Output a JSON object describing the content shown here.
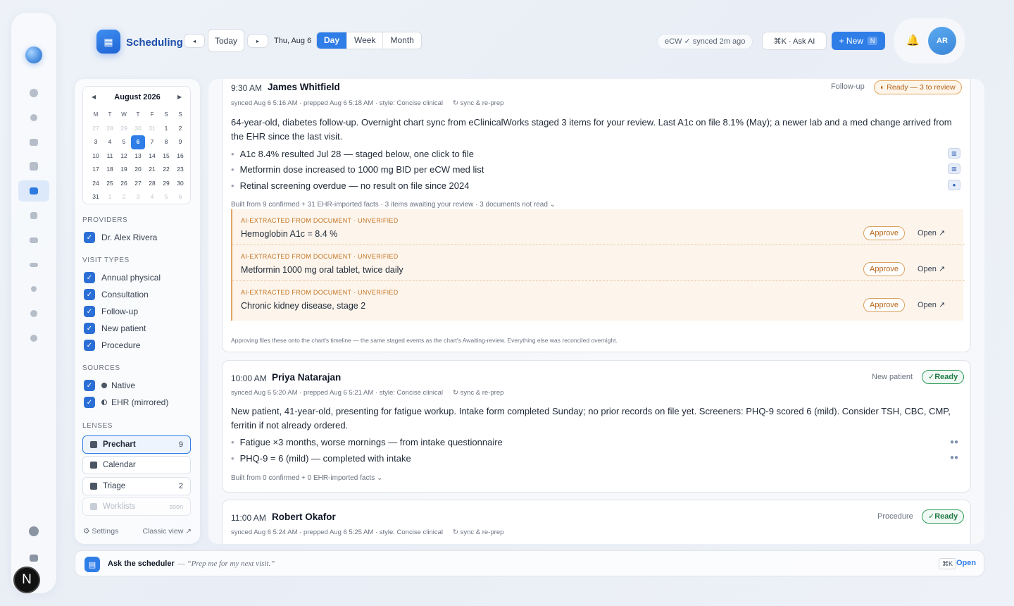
{
  "header": {
    "app_title": "Scheduling",
    "prev_label": "◂",
    "today_label": "Today",
    "next_label": "▸",
    "date_label": "Thu, Aug 6",
    "views": [
      "Day",
      "Week",
      "Month"
    ],
    "active_view": "Day",
    "sync_status": "eCW ✓ synced 2m ago",
    "ask_ai_label": "⌘K · Ask AI",
    "new_label": "+ New",
    "new_kbd": "N",
    "avatar_initials": "AR"
  },
  "calendar": {
    "month_label": "August 2026",
    "dow": [
      "M",
      "T",
      "W",
      "T",
      "F",
      "S",
      "S"
    ],
    "weeks": [
      [
        "27",
        "28",
        "29",
        "30",
        "31",
        "1",
        "2"
      ],
      [
        "3",
        "4",
        "5",
        "6",
        "7",
        "8",
        "9"
      ],
      [
        "10",
        "11",
        "12",
        "13",
        "14",
        "15",
        "16"
      ],
      [
        "17",
        "18",
        "19",
        "20",
        "21",
        "22",
        "23"
      ],
      [
        "24",
        "25",
        "26",
        "27",
        "28",
        "29",
        "30"
      ],
      [
        "31",
        "1",
        "2",
        "3",
        "4",
        "5",
        "6"
      ]
    ],
    "selected_day": "6"
  },
  "sidebar": {
    "providers_label": "PROVIDERS",
    "providers": [
      "Dr. Alex Rivera"
    ],
    "visit_types_label": "VISIT TYPES",
    "visit_types": [
      "Annual physical",
      "Consultation",
      "Follow-up",
      "New patient",
      "Procedure"
    ],
    "sources_label": "SOURCES",
    "sources": [
      "Native",
      "EHR (mirrored)"
    ],
    "lenses_label": "LENSES",
    "lenses": [
      {
        "label": "Prechart",
        "count": "9"
      },
      {
        "label": "Calendar",
        "count": ""
      },
      {
        "label": "Triage",
        "count": "2"
      },
      {
        "label": "Worklists",
        "count": "soon"
      }
    ],
    "settings_label": "Settings",
    "classic_label": "Classic view ↗"
  },
  "appointments": [
    {
      "time": "9:30 AM",
      "name": "James Whitfield",
      "meta": "synced Aug 6 5:16 AM · prepped Aug 6 5:18 AM · style: Concise clinical",
      "sync_action": "sync & re-prep",
      "visit_type": "Follow-up",
      "status": "Ready — 3 to review",
      "summary": "64-year-old, diabetes follow-up. Overnight chart sync from eClinicalWorks staged 3 items for your review. Last A1c on file 8.1% (May); a newer lab and a med change arrived from the EHR since the last visit.",
      "bullets": [
        "A1c 8.4% resulted Jul 28 — staged below, one click to file",
        "Metformin dose increased to 1000 mg BID per eCW med list",
        "Retinal screening overdue — no result on file since 2024"
      ],
      "built_from": "Built from 9 confirmed + 31 EHR-imported facts · 3 items awaiting your review · 3 documents not read ⌄",
      "staged_label": "AI-EXTRACTED FROM DOCUMENT · UNVERIFIED",
      "staged": [
        "Hemoglobin A1c = 8.4 %",
        "Metformin 1000 mg oral tablet, twice daily",
        "Chronic kidney disease, stage 2"
      ],
      "approve_label": "Approve",
      "open_label": "Open ↗",
      "footnote": "Approving files these onto the chart's timeline — the same staged events as the chart's Awaiting-review. Everything else was reconciled overnight."
    },
    {
      "time": "10:00 AM",
      "name": "Priya Natarajan",
      "meta": "synced Aug 6 5:20 AM · prepped Aug 6 5:21 AM · style: Concise clinical",
      "sync_action": "sync & re-prep",
      "visit_type": "New patient",
      "status": "✓Ready",
      "summary": "New patient, 41-year-old, presenting for fatigue workup. Intake form completed Sunday; no prior records on file yet. Screeners: PHQ-9 scored 6 (mild). Consider TSH, CBC, CMP, ferritin if not already ordered.",
      "bullets": [
        "Fatigue ×3 months, worse mornings — from intake questionnaire",
        "PHQ-9 = 6 (mild) — completed with intake"
      ],
      "built_from": "Built from 0 confirmed + 0 EHR-imported facts ⌄"
    },
    {
      "time": "11:00 AM",
      "name": "Robert Okafor",
      "meta": "synced Aug 6 5:24 AM · prepped Aug 6 5:25 AM · style: Concise clinical",
      "sync_action": "sync & re-prep",
      "visit_type": "Procedure",
      "status": "✓Ready"
    }
  ],
  "askbar": {
    "title": "Ask the scheduler",
    "hint": "— “Prep me for my next visit.”",
    "kbd": "⌘K",
    "open_label": "Open"
  },
  "colors": {
    "accent": "#2f7ee8",
    "ready_green": "#1f7a45",
    "warn_orange": "#b05e12"
  }
}
